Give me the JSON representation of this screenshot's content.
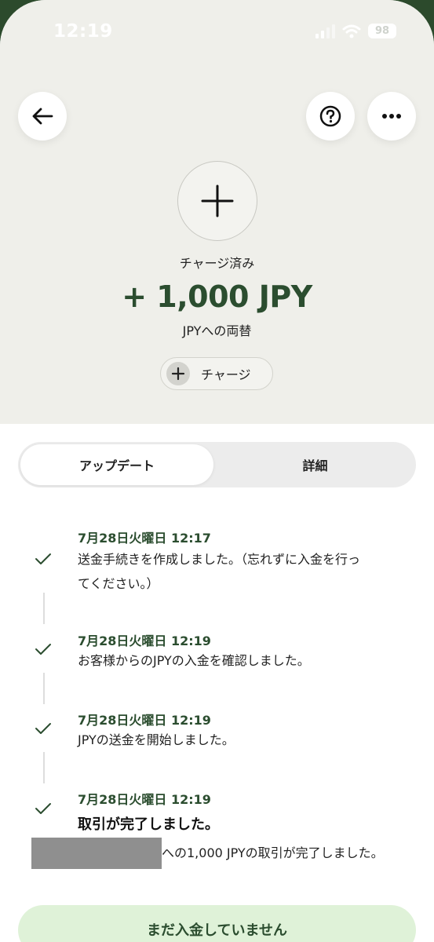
{
  "status_bar": {
    "time": "12:19",
    "battery": "98"
  },
  "header": {
    "back_icon": "arrow-left-icon",
    "help_icon": "question-circle-icon",
    "more_icon": "ellipsis-icon"
  },
  "summary": {
    "icon": "plus-icon",
    "status": "チャージ済み",
    "amount": "+ 1,000 JPY",
    "subtitle": "JPYへの両替",
    "charge_label": "チャージ"
  },
  "tabs": [
    {
      "label": "アップデート",
      "active": true
    },
    {
      "label": "詳細",
      "active": false
    }
  ],
  "timeline": [
    {
      "time": "7月28日火曜日 12:17",
      "line1": "送金手続きを作成しました。（忘れずに入金を行っ",
      "line2": "てください。）"
    },
    {
      "time": "7月28日火曜日 12:19",
      "text": "お客様からのJPYの入金を確認しました。"
    },
    {
      "time": "7月28日火曜日 12:19",
      "text": "JPYの送金を開始しました。"
    },
    {
      "time": "7月28日火曜日 12:19",
      "title": "取引が完了しました。",
      "detail": "への1,000 JPYの取引が完了しました。"
    }
  ],
  "cta_label": "まだ入金していません",
  "colors": {
    "accent": "#2b4d2f",
    "hero_bg": "#efefea",
    "cta_bg": "#dff2d8"
  }
}
